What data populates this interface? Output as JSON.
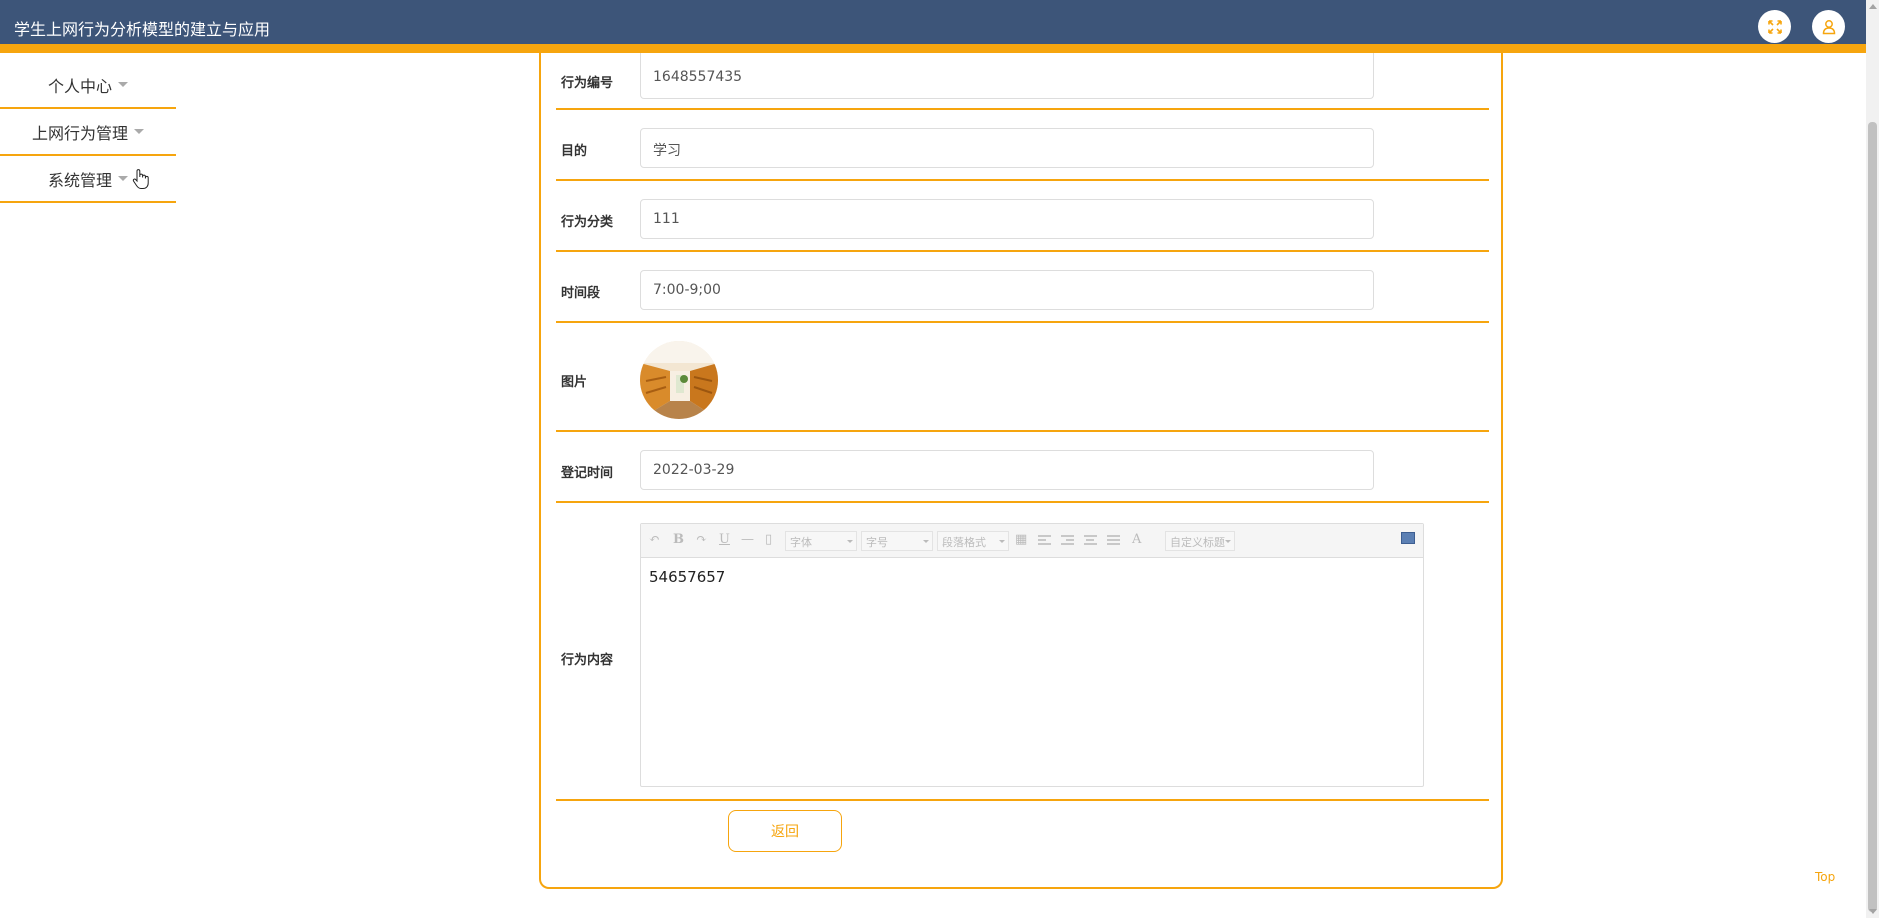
{
  "header": {
    "title": "学生上网行为分析模型的建立与应用",
    "fullscreen_icon": "fullscreen-icon",
    "user_icon": "user-icon"
  },
  "sidebar": {
    "items": [
      {
        "label": "个人中心"
      },
      {
        "label": "上网行为管理"
      },
      {
        "label": "系统管理"
      }
    ]
  },
  "form": {
    "behavior_no": {
      "label": "行为编号",
      "value": "1648557435"
    },
    "purpose": {
      "label": "目的",
      "value": "学习"
    },
    "category": {
      "label": "行为分类",
      "value": "111"
    },
    "time_period": {
      "label": "时间段",
      "value": "7:00-9;00"
    },
    "picture": {
      "label": "图片"
    },
    "register_time": {
      "label": "登记时间",
      "value": "2022-03-29"
    },
    "content": {
      "label": "行为内容",
      "value": "54657657"
    }
  },
  "editor": {
    "font_select": "字体",
    "size_select": "字号",
    "paragraph_select": "段落格式",
    "custom_title_select": "自定义标题",
    "font_color_glyph": "A"
  },
  "actions": {
    "back_label": "返回"
  },
  "footer": {
    "top_label": "Top"
  },
  "colors": {
    "header_bg": "#3d5579",
    "accent": "#f6a50e"
  }
}
